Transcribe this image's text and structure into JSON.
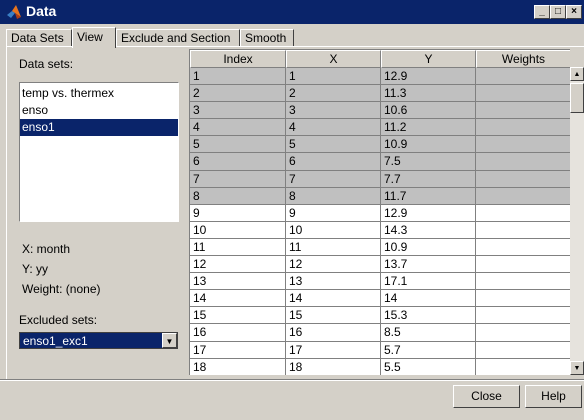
{
  "window": {
    "title": "Data",
    "icon": "matlab-logo-icon",
    "controls": {
      "minimize": "_",
      "maximize": "□",
      "close": "×"
    }
  },
  "tabs": [
    {
      "label": "Data Sets"
    },
    {
      "label": "View"
    },
    {
      "label": "Exclude and Section"
    },
    {
      "label": "Smooth"
    }
  ],
  "left_panel": {
    "data_sets_label": "Data sets:",
    "data_sets": [
      "temp vs. thermex",
      "enso",
      "enso1"
    ],
    "selected_data_set": "enso1",
    "x_label": "X: month",
    "y_label": "Y: yy",
    "weight_label": "Weight: (none)",
    "excluded_sets_label": "Excluded sets:",
    "excluded_set_value": "enso1_exc1"
  },
  "table": {
    "columns": [
      "Index",
      "X",
      "Y",
      "Weights"
    ],
    "rows": [
      {
        "index": "1",
        "x": "1",
        "y": "12.9",
        "w": "",
        "excluded": true
      },
      {
        "index": "2",
        "x": "2",
        "y": "11.3",
        "w": "",
        "excluded": true
      },
      {
        "index": "3",
        "x": "3",
        "y": "10.6",
        "w": "",
        "excluded": true
      },
      {
        "index": "4",
        "x": "4",
        "y": "11.2",
        "w": "",
        "excluded": true
      },
      {
        "index": "5",
        "x": "5",
        "y": "10.9",
        "w": "",
        "excluded": true
      },
      {
        "index": "6",
        "x": "6",
        "y": "7.5",
        "w": "",
        "excluded": true
      },
      {
        "index": "7",
        "x": "7",
        "y": "7.7",
        "w": "",
        "excluded": true
      },
      {
        "index": "8",
        "x": "8",
        "y": "11.7",
        "w": "",
        "excluded": true
      },
      {
        "index": "9",
        "x": "9",
        "y": "12.9",
        "w": "",
        "excluded": false
      },
      {
        "index": "10",
        "x": "10",
        "y": "14.3",
        "w": "",
        "excluded": false
      },
      {
        "index": "11",
        "x": "11",
        "y": "10.9",
        "w": "",
        "excluded": false
      },
      {
        "index": "12",
        "x": "12",
        "y": "13.7",
        "w": "",
        "excluded": false
      },
      {
        "index": "13",
        "x": "13",
        "y": "17.1",
        "w": "",
        "excluded": false
      },
      {
        "index": "14",
        "x": "14",
        "y": "14",
        "w": "",
        "excluded": false
      },
      {
        "index": "15",
        "x": "15",
        "y": "15.3",
        "w": "",
        "excluded": false
      },
      {
        "index": "16",
        "x": "16",
        "y": "8.5",
        "w": "",
        "excluded": false
      },
      {
        "index": "17",
        "x": "17",
        "y": "5.7",
        "w": "",
        "excluded": false
      },
      {
        "index": "18",
        "x": "18",
        "y": "5.5",
        "w": "",
        "excluded": false
      }
    ]
  },
  "buttons": {
    "close": "Close",
    "help": "Help"
  },
  "colors": {
    "title_bar": "#0a246a",
    "selection": "#0a246a",
    "excluded_row": "#c0c0c0"
  }
}
